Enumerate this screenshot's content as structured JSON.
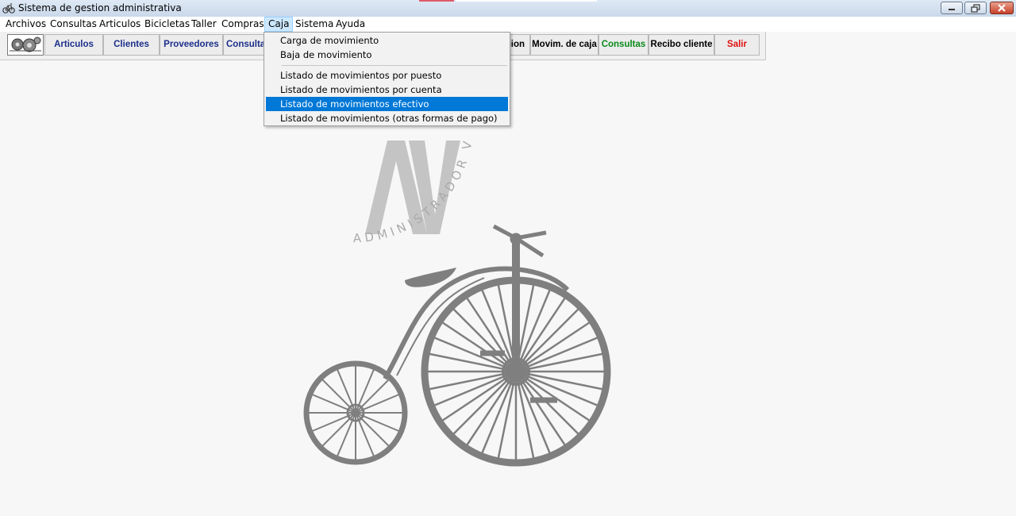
{
  "window": {
    "title": "Sistema de gestion administrativa"
  },
  "menubar": {
    "items": [
      {
        "label": "Archivos"
      },
      {
        "label": "Consultas"
      },
      {
        "label": "Articulos"
      },
      {
        "label": "Bicicletas"
      },
      {
        "label": "Taller"
      },
      {
        "label": "Compras"
      },
      {
        "label": "Caja"
      },
      {
        "label": "Sistema"
      },
      {
        "label": "Ayuda"
      }
    ],
    "active": "Caja"
  },
  "toolbar": {
    "buttons": [
      {
        "label": "Articulos",
        "color": "#1c2f8a"
      },
      {
        "label": "Clientes",
        "color": "#1c2f8a"
      },
      {
        "label": "Proveedores",
        "color": "#1c2f8a"
      },
      {
        "label": "Consultas",
        "color": "#1c2f8a"
      },
      {
        "label": "cion",
        "color": "#000000"
      },
      {
        "label": "Movim. de caja",
        "color": "#000000"
      },
      {
        "label": "Consultas",
        "color": "#0a8a1a"
      },
      {
        "label": "Recibo cliente",
        "color": "#000000"
      },
      {
        "label": "Salir",
        "color": "#e01010"
      }
    ]
  },
  "dropdown": {
    "items": [
      {
        "label": "Carga de movimiento"
      },
      {
        "label": "Baja de movimiento"
      },
      {
        "label": "Listado de movimientos por puesto"
      },
      {
        "label": "Listado de movimientos por cuenta"
      },
      {
        "label": "Listado de movimientos efectivo"
      },
      {
        "label": "Listado de movimientos (otras formas de pago)"
      }
    ],
    "highlighted": "Listado de movimientos efectivo",
    "highlight_color": "#0078d7"
  },
  "logo": {
    "initials": "AV",
    "arc_text": "ADMINISTRADOR VELO"
  }
}
